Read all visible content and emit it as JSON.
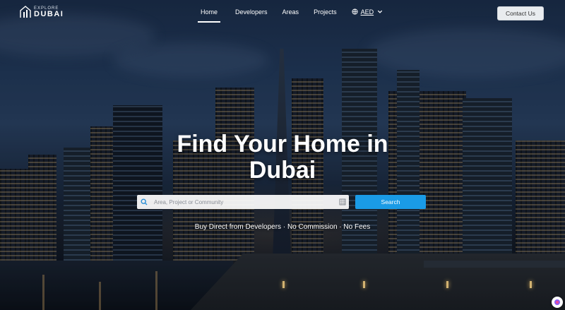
{
  "brand": {
    "small": "EXPLORE",
    "big": "DUBAI"
  },
  "nav": {
    "items": [
      {
        "label": "Home",
        "active": true
      },
      {
        "label": "Developers",
        "active": false
      },
      {
        "label": "Areas",
        "active": false
      },
      {
        "label": "Projects",
        "active": false
      }
    ],
    "currency": {
      "label": "AED"
    }
  },
  "header": {
    "contact_label": "Contact Us"
  },
  "hero": {
    "title_line1": "Find Your Home in",
    "title_line2": "Dubai",
    "search_placeholder": "Area, Project or Community",
    "search_value": "",
    "search_button": "Search",
    "tagline": "Buy Direct from Developers · No Commission · No Fees"
  },
  "colors": {
    "accent": "#1a9be6",
    "contact_bg": "#e9ecef"
  },
  "icons": {
    "logo": "building-outline-icon",
    "currency": "globe-icon",
    "chevron": "chevron-down-icon",
    "search": "search-icon",
    "filter": "map-grid-icon",
    "chat": "chat-widget-icon"
  }
}
